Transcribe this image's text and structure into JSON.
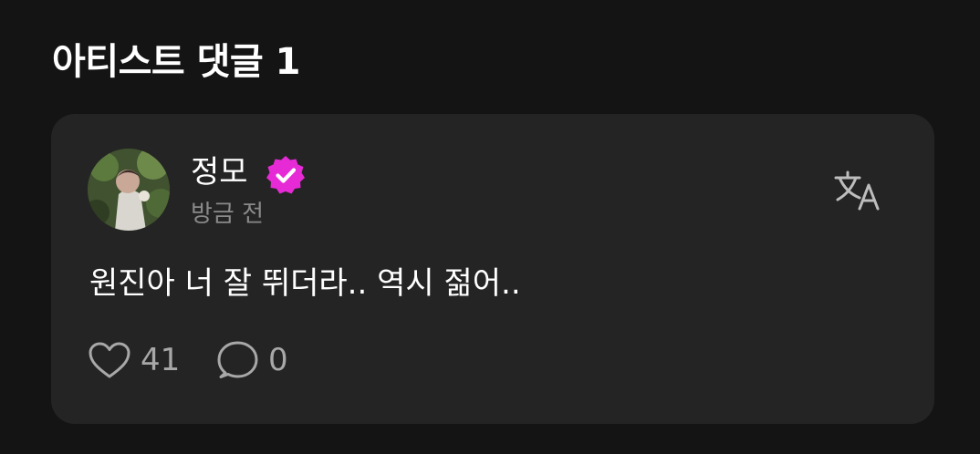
{
  "section": {
    "title": "아티스트 댓글 1"
  },
  "comment": {
    "author": "정모",
    "verified": true,
    "timestamp": "방금 전",
    "text": "원진아 너 잘 뛰더라.. 역시 젊어..",
    "likes": "41",
    "replies": "0"
  },
  "icons": {
    "verified": "verified-badge-icon",
    "translate": "translate-icon",
    "like": "heart-icon",
    "reply": "speech-bubble-icon"
  },
  "colors": {
    "background": "#141414",
    "card": "#242424",
    "verified_badge": "#e62ad6",
    "muted_text": "#8a8a8a"
  }
}
